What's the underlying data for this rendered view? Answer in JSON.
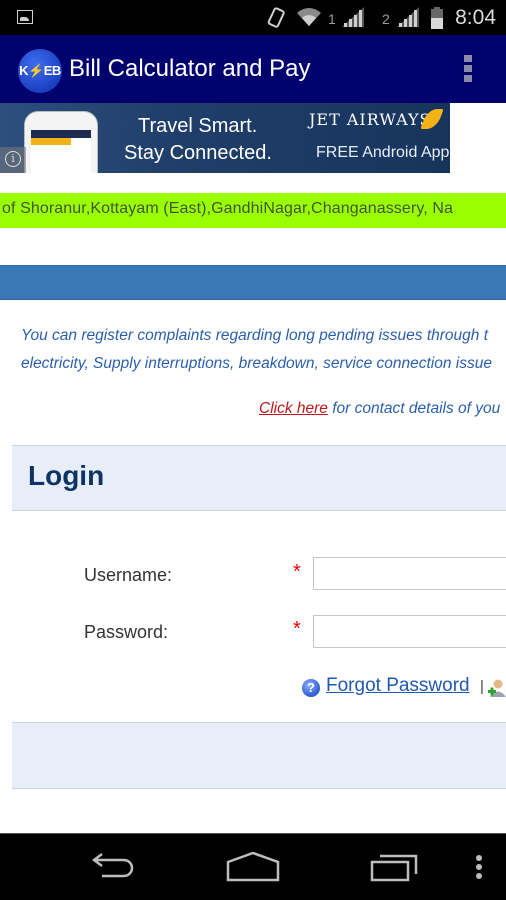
{
  "status_bar": {
    "time": "8:04",
    "sim1_label": "1",
    "sim2_label": "2",
    "icons": [
      "gallery-notification-icon",
      "vibrate-icon",
      "wifi-icon",
      "signal-icon",
      "signal-icon",
      "battery-icon"
    ]
  },
  "app_bar": {
    "logo_text": "K⚡EB",
    "title": "Bill Calculator and Pay",
    "overflow_icon": "overflow-menu-icon"
  },
  "ad_banner": {
    "line1": "Travel Smart.",
    "line2": "Stay Connected.",
    "brand": "JET AIRWAYS",
    "cta": "FREE Android App",
    "info_icon": "i"
  },
  "ticker": {
    "text": "of Shoranur,Kottayam (East),GandhiNagar,Changanassery, Na"
  },
  "notice": {
    "line1": "You can register complaints regarding long pending issues through t",
    "line2": "electricity, Supply interruptions, breakdown, service connection issue",
    "link_text": "Click here",
    "link_suffix": " for contact details of you"
  },
  "login": {
    "heading": "Login",
    "username_label": "Username:",
    "password_label": "Password:",
    "required_marker": "*",
    "username_value": "",
    "password_value": "",
    "help_glyph": "?",
    "forgot_password": "Forgot Password",
    "separator": "|"
  },
  "colors": {
    "app_bar": "#02026e",
    "ticker": "#99ff00",
    "blue_bar": "#3c77b5",
    "link_red": "#c0191b",
    "notice_text": "#2a5fae",
    "login_heading": "#0e3466"
  }
}
